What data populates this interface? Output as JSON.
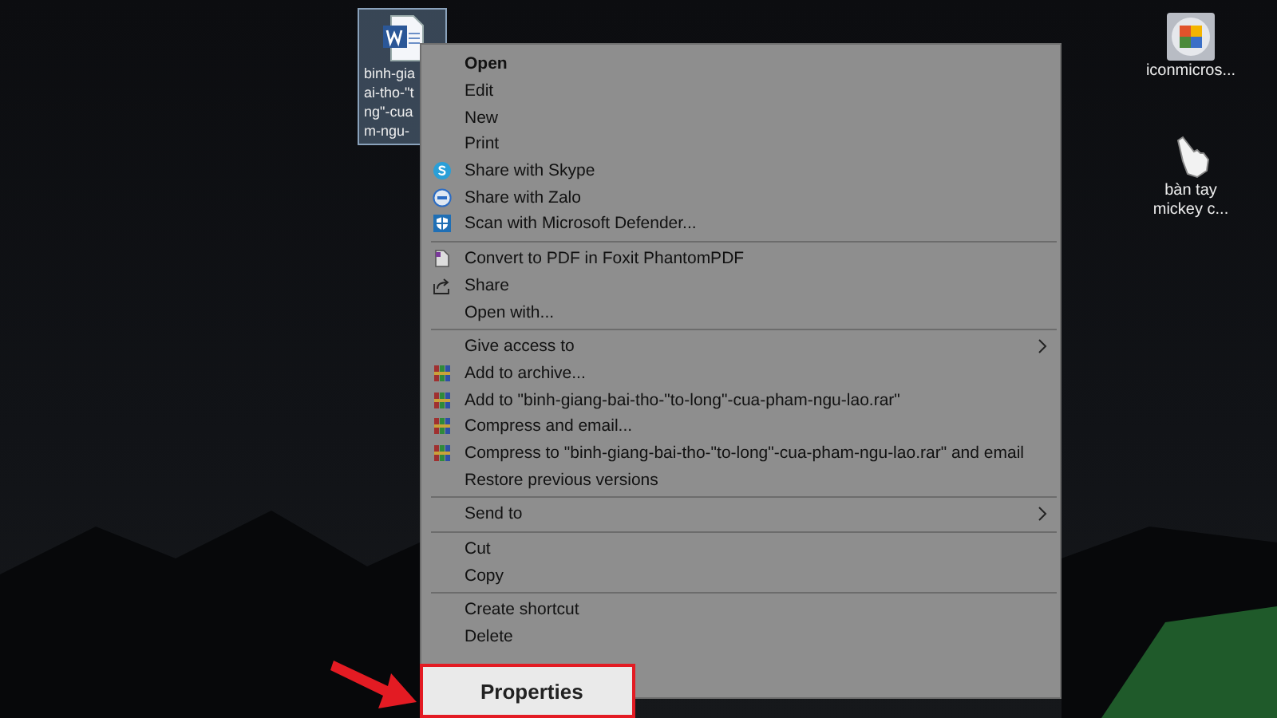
{
  "desktop_icons": [
    {
      "kind": "word-document",
      "label_lines": [
        "binh-gia",
        "ai-tho-\"t",
        "ng\"-cua",
        "m-ngu-"
      ],
      "selected": true
    },
    {
      "kind": "office",
      "label_lines": [
        "iconmicros..."
      ],
      "selected": false
    },
    {
      "kind": "hand-cursor",
      "label_lines": [
        "bàn tay",
        "mickey c..."
      ],
      "selected": false
    }
  ],
  "context_menu": {
    "sections": [
      [
        {
          "label": "Open",
          "default": true
        },
        {
          "label": "Edit",
          "default": false
        },
        {
          "label": "New",
          "default": false
        },
        {
          "label": "Print",
          "default": false
        },
        {
          "label": "Share with Skype",
          "default": false,
          "kind": "skype"
        },
        {
          "label": "Share with Zalo",
          "default": false,
          "kind": "zalo"
        },
        {
          "label": "Scan with Microsoft Defender...",
          "default": false,
          "kind": "defender"
        }
      ],
      [
        {
          "label": "Convert to PDF in Foxit PhantomPDF",
          "default": false,
          "kind": "pdf"
        },
        {
          "label": "Share",
          "default": false,
          "kind": "share"
        },
        {
          "label": "Open with...",
          "default": false
        }
      ],
      [
        {
          "label": "Give access to",
          "default": false,
          "submenu": true
        },
        {
          "label": "Add to archive...",
          "default": false,
          "kind": "archive"
        },
        {
          "label": "Add to \"binh-giang-bai-tho-\"to-long\"-cua-pham-ngu-lao.rar\"",
          "default": false,
          "kind": "archive"
        },
        {
          "label": "Compress and email...",
          "default": false,
          "kind": "archive"
        },
        {
          "label": "Compress to \"binh-giang-bai-tho-\"to-long\"-cua-pham-ngu-lao.rar\" and email",
          "default": false,
          "kind": "archive"
        },
        {
          "label": "Restore previous versions",
          "default": false
        }
      ],
      [
        {
          "label": "Send to",
          "default": false,
          "submenu": true
        }
      ],
      [
        {
          "label": "Cut",
          "default": false
        },
        {
          "label": "Copy",
          "default": false
        }
      ],
      [
        {
          "label": "Create shortcut",
          "default": false
        },
        {
          "label": "Delete",
          "default": false
        }
      ]
    ],
    "highlighted_item": {
      "label": "Properties"
    }
  }
}
